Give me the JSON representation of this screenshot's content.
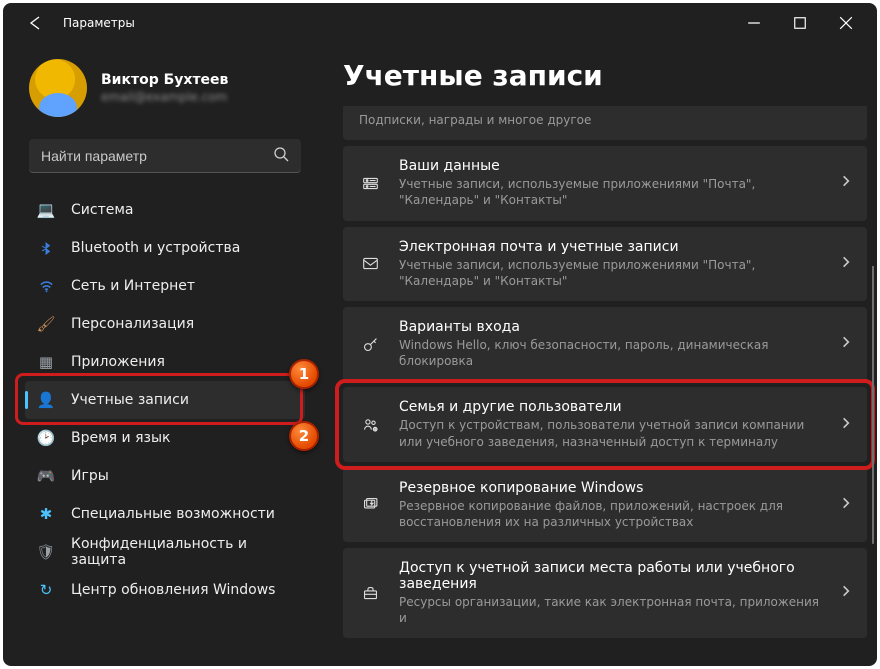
{
  "app": {
    "title": "Параметры"
  },
  "user": {
    "name": "Виктор Бухтеев",
    "email": "email@example.com"
  },
  "search": {
    "placeholder": "Найти параметр"
  },
  "sidebar": {
    "items": [
      {
        "label": "Система",
        "icon": "💻",
        "color": "#3a7fe0"
      },
      {
        "label": "Bluetooth и устройства",
        "icon": "bt",
        "color": "#3a7fe0"
      },
      {
        "label": "Сеть и Интернет",
        "icon": "wifi",
        "color": "#3a7fe0"
      },
      {
        "label": "Персонализация",
        "icon": "🖌",
        "color": "#c98d57"
      },
      {
        "label": "Приложения",
        "icon": "▦",
        "color": "#9aa0a6"
      },
      {
        "label": "Учетные записи",
        "icon": "👤",
        "color": "#31cf7e",
        "selected": true
      },
      {
        "label": "Время и язык",
        "icon": "🕑",
        "color": "#b0b0b0"
      },
      {
        "label": "Игры",
        "icon": "🎮",
        "color": "#9aa0a6"
      },
      {
        "label": "Специальные возможности",
        "icon": "✱",
        "color": "#4cc2ff"
      },
      {
        "label": "Конфиденциальность и защита",
        "icon": "🛡",
        "color": "#9aa0a6"
      },
      {
        "label": "Центр обновления Windows",
        "icon": "↻",
        "color": "#4cc2ff"
      }
    ]
  },
  "page": {
    "title": "Учетные записи"
  },
  "cards": [
    {
      "title": "",
      "desc": "Подписки, награды и многое другое",
      "icon": "",
      "truncated": true
    },
    {
      "title": "Ваши данные",
      "desc": "Учетные записи, используемые приложениями \"Почта\", \"Календарь\" и \"Контакты\"",
      "icon": "id"
    },
    {
      "title": "Электронная почта и учетные записи",
      "desc": "Учетные записи, используемые приложениями \"Почта\", \"Календарь\" и \"Контакты\"",
      "icon": "mail"
    },
    {
      "title": "Варианты входа",
      "desc": "Windows Hello, ключ безопасности, пароль, динамическая блокировка",
      "icon": "key"
    },
    {
      "title": "Семья и другие пользователи",
      "desc": "Доступ к устройствам, пользователи учетной записи компании или учебного заведения, назначенный доступ к терминалу",
      "icon": "family",
      "highlighted": true
    },
    {
      "title": "Резервное копирование Windows",
      "desc": "Резервное копирование файлов, приложений, настроек для восстановления их на различных устройствах",
      "icon": "backup"
    },
    {
      "title": "Доступ к учетной записи места работы или учебного заведения",
      "desc": "Ресурсы организации, такие как электронная почта, приложения и",
      "icon": "briefcase"
    }
  ],
  "annotations": {
    "badge1": "1",
    "badge2": "2"
  }
}
